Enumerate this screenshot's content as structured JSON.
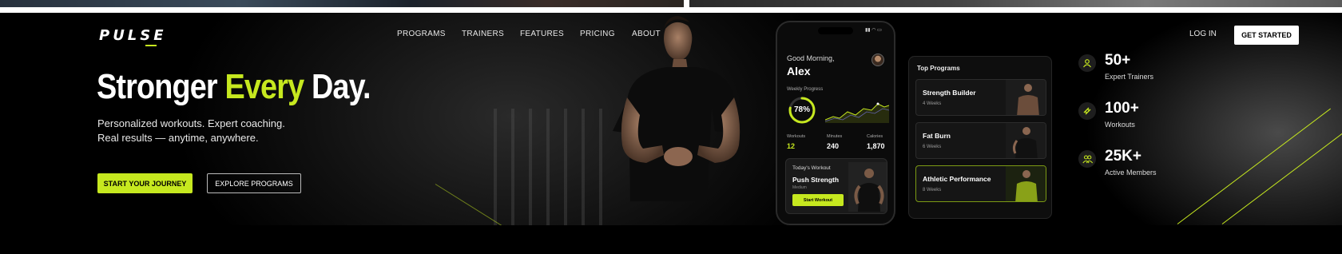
{
  "app": {
    "logo": "PULSE"
  },
  "nav": {
    "items": [
      "PROGRAMS",
      "TRAINERS",
      "FEATURES",
      "PRICING",
      "ABOUT"
    ],
    "login": "LOG IN",
    "get_started": "GET STARTED"
  },
  "hero": {
    "headline_1": "Stronger",
    "headline_accent": "Every",
    "headline_2": "Day.",
    "sub_1": "Personalized workouts. Expert coaching.",
    "sub_2": "Real results — anytime, anywhere.",
    "cta_primary": "START YOUR JOURNEY",
    "cta_secondary": "EXPLORE PROGRAMS"
  },
  "phone": {
    "greeting": "Good Morning,",
    "name": "Alex",
    "weekly_label": "Weekly Progress",
    "progress_text": "78%",
    "progress_value": 0.78,
    "stats": [
      {
        "label": "Workouts",
        "value": "12"
      },
      {
        "label": "Minutes",
        "value": "240"
      },
      {
        "label": "Calories",
        "value": "1,870"
      }
    ],
    "today_label": "Today's Workout",
    "today_name": "Push Strength",
    "today_sub": "Medium",
    "start_button": "Start Workout"
  },
  "programs": {
    "title": "Top Programs",
    "items": [
      {
        "name": "Strength Builder",
        "weeks": "4 Weeks"
      },
      {
        "name": "Fat Burn",
        "weeks": "6 Weeks"
      },
      {
        "name": "Athletic Performance",
        "weeks": "8 Weeks"
      }
    ]
  },
  "stats": [
    {
      "icon": "user-icon",
      "number": "50+",
      "label": "Expert Trainers"
    },
    {
      "icon": "dumbbell-icon",
      "number": "100+",
      "label": "Workouts"
    },
    {
      "icon": "users-icon",
      "number": "25K+",
      "label": "Active Members"
    }
  ],
  "colors": {
    "accent": "#c6e81f",
    "background": "#000000",
    "text": "#ffffff"
  }
}
